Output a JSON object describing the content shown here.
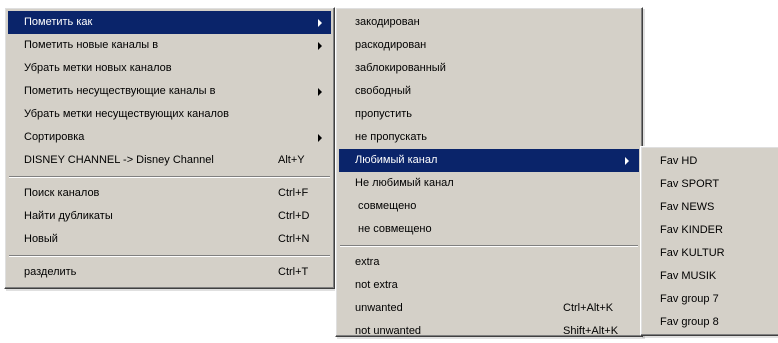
{
  "main_menu": {
    "items": [
      {
        "label": "Пометить как",
        "shortcut": "",
        "submenu": true
      },
      {
        "label": "Пометить новые каналы в",
        "shortcut": "",
        "submenu": true
      },
      {
        "label": "Убрать метки новых каналов",
        "shortcut": ""
      },
      {
        "label": "Пометить несуществующие каналы в",
        "shortcut": "",
        "submenu": true
      },
      {
        "label": "Убрать метки несуществующих каналов",
        "shortcut": ""
      },
      {
        "label": "Сортировка",
        "shortcut": "",
        "submenu": true
      },
      {
        "label": "DISNEY CHANNEL -> Disney Channel",
        "shortcut": "Alt+Y"
      },
      {
        "label": "Поиск каналов",
        "shortcut": "Ctrl+F"
      },
      {
        "label": "Найти дубликаты",
        "shortcut": "Ctrl+D"
      },
      {
        "label": "Новый",
        "shortcut": "Ctrl+N"
      },
      {
        "label": "разделить",
        "shortcut": "Ctrl+T"
      }
    ]
  },
  "mark_as_submenu": {
    "items": [
      {
        "label": "закодирован",
        "shortcut": ""
      },
      {
        "label": "раскодирован",
        "shortcut": ""
      },
      {
        "label": "заблокированный",
        "shortcut": ""
      },
      {
        "label": "свободный",
        "shortcut": ""
      },
      {
        "label": "пропустить",
        "shortcut": ""
      },
      {
        "label": "не пропускать",
        "shortcut": ""
      },
      {
        "label": "Любимый канал",
        "shortcut": "",
        "submenu": true
      },
      {
        "label": "Не любимый канал",
        "shortcut": ""
      },
      {
        "label": "совмещено",
        "shortcut": ""
      },
      {
        "label": "не совмещено",
        "shortcut": ""
      },
      {
        "label": "extra",
        "shortcut": ""
      },
      {
        "label": "not extra",
        "shortcut": ""
      },
      {
        "label": "unwanted",
        "shortcut": "Ctrl+Alt+K"
      },
      {
        "label": "not unwanted",
        "shortcut": "Shift+Alt+K"
      }
    ]
  },
  "favorites_submenu": {
    "items": [
      {
        "label": "Fav HD"
      },
      {
        "label": "Fav SPORT"
      },
      {
        "label": "Fav NEWS"
      },
      {
        "label": "Fav KINDER"
      },
      {
        "label": "Fav KULTUR"
      },
      {
        "label": "Fav MUSIK"
      },
      {
        "label": "Fav group 7"
      },
      {
        "label": "Fav group 8"
      }
    ]
  },
  "colors": {
    "menu_background": "#d4d0c8",
    "highlight": "#0a246a",
    "highlight_text": "#ffffff"
  }
}
